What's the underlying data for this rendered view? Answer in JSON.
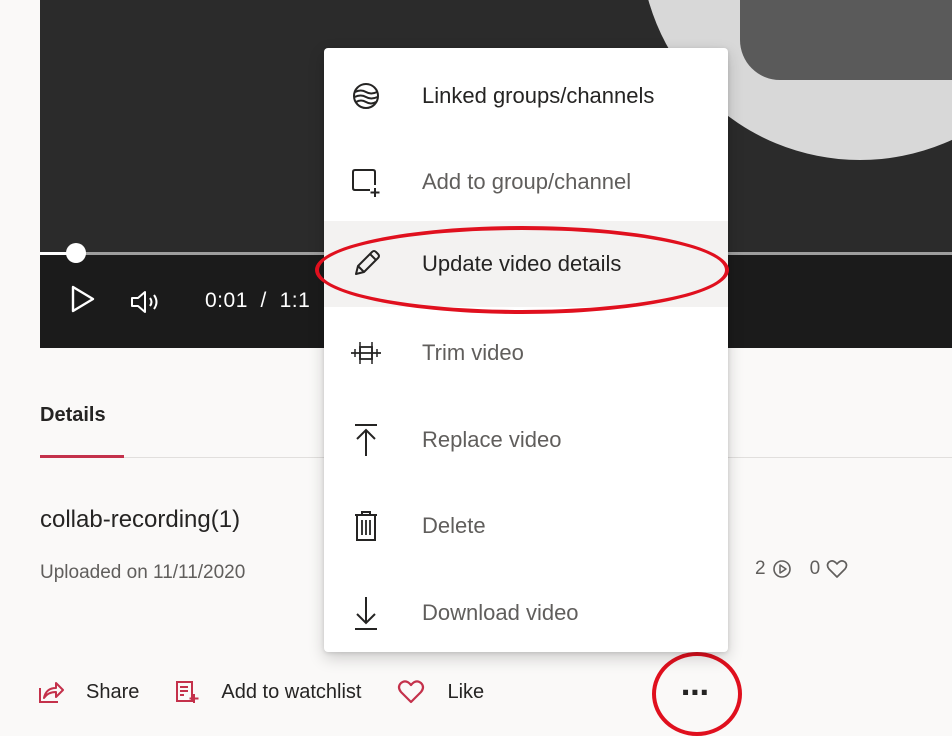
{
  "player": {
    "current_time": "0:01",
    "separator": "/",
    "duration_partial": "1:1",
    "progress_fraction": 0.04
  },
  "details": {
    "tab_label": "Details",
    "title": "collab-recording(1)",
    "upload_text": "Uploaded on 11/11/2020",
    "views": "2",
    "likes": "0"
  },
  "actions": {
    "share": "Share",
    "add_to_watchlist": "Add to watchlist",
    "like": "Like",
    "more": "⋯"
  },
  "menu": {
    "items": [
      {
        "label": "Linked groups/channels",
        "icon": "linked-globe-icon"
      },
      {
        "label": "Add to group/channel",
        "icon": "add-to-group-icon"
      },
      {
        "label": "Update video details",
        "icon": "pencil-icon"
      },
      {
        "label": "Trim video",
        "icon": "trim-icon"
      },
      {
        "label": "Replace video",
        "icon": "upload-arrow-icon"
      },
      {
        "label": "Delete",
        "icon": "trash-icon"
      },
      {
        "label": "Download video",
        "icon": "download-icon"
      }
    ]
  },
  "colors": {
    "accent": "#c4314b",
    "annotation_ring": "#e0101e"
  }
}
